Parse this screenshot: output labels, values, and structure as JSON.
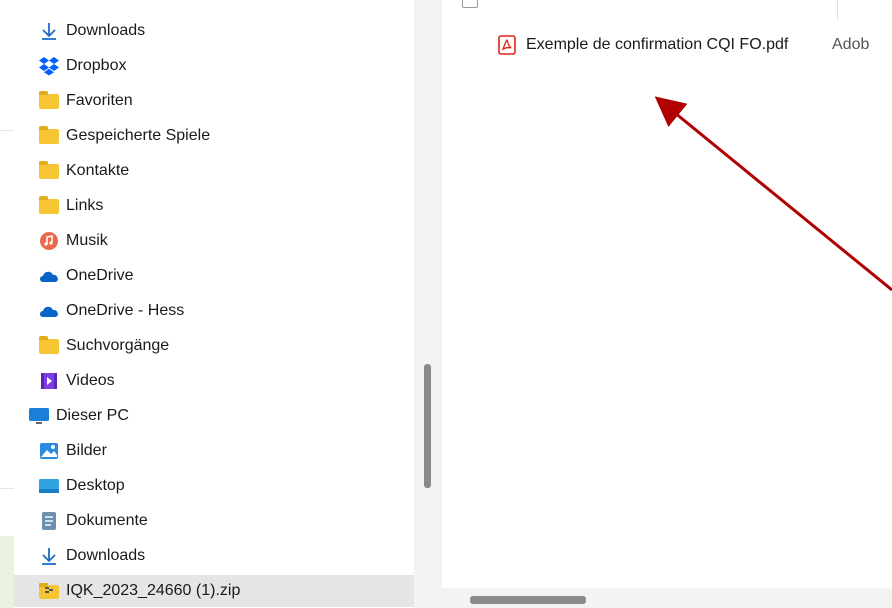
{
  "nav_items": [
    {
      "label": "Downloads",
      "icon": "download-arrow-icon",
      "indent": 1
    },
    {
      "label": "Dropbox",
      "icon": "dropbox-icon",
      "indent": 1
    },
    {
      "label": "Favoriten",
      "icon": "folder-icon",
      "indent": 1
    },
    {
      "label": "Gespeicherte Spiele",
      "icon": "folder-icon",
      "indent": 1
    },
    {
      "label": "Kontakte",
      "icon": "folder-icon",
      "indent": 1
    },
    {
      "label": "Links",
      "icon": "folder-icon",
      "indent": 1
    },
    {
      "label": "Musik",
      "icon": "music-icon",
      "indent": 1
    },
    {
      "label": "OneDrive",
      "icon": "onedrive-cloud-icon",
      "indent": 1
    },
    {
      "label": "OneDrive - Hess",
      "icon": "onedrive-cloud-icon",
      "indent": 1
    },
    {
      "label": "Suchvorgänge",
      "icon": "folder-icon",
      "indent": 1
    },
    {
      "label": "Videos",
      "icon": "videos-icon",
      "indent": 1
    },
    {
      "label": "Dieser PC",
      "icon": "monitor-icon",
      "indent": 0
    },
    {
      "label": "Bilder",
      "icon": "pictures-icon",
      "indent": 1
    },
    {
      "label": "Desktop",
      "icon": "desktop-icon",
      "indent": 1
    },
    {
      "label": "Dokumente",
      "icon": "documents-icon",
      "indent": 1
    },
    {
      "label": "Downloads",
      "icon": "download-arrow-icon",
      "indent": 1
    },
    {
      "label": "IQK_2023_24660 (1).zip",
      "icon": "zip-folder-icon",
      "indent": 1,
      "selected": true
    }
  ],
  "files": [
    {
      "name": "Exemple de confirmation CQI FO.pdf",
      "type_partial": "Adob",
      "icon": "pdf-icon"
    }
  ],
  "colors": {
    "accent_arrow": "#b00000",
    "folder": "#f5c533",
    "selection": "#e5e5e5",
    "pdf_red": "#e2231a",
    "onedrive": "#0a64c8"
  }
}
